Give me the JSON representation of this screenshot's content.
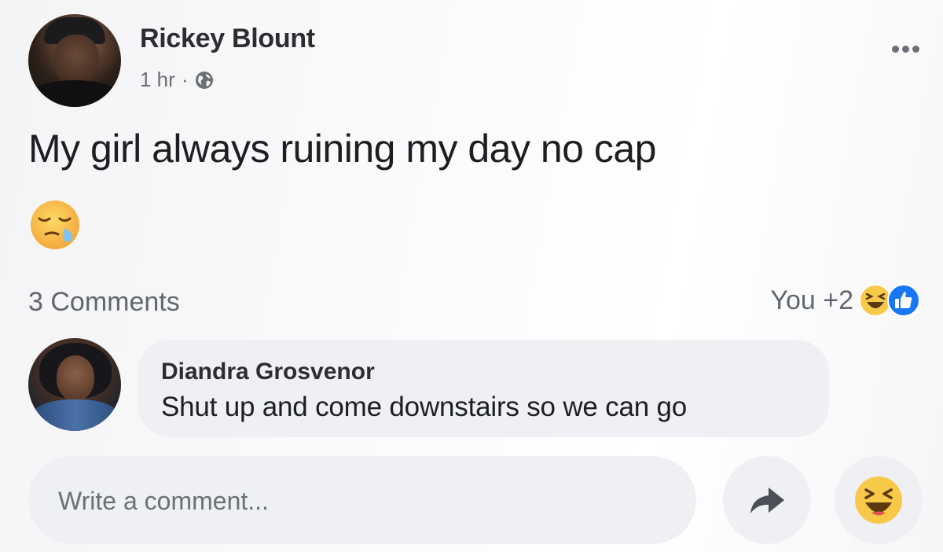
{
  "post": {
    "author_name": "Rickey Blount",
    "time": "1 hr",
    "separator": "·",
    "privacy_icon": "globe-icon",
    "text": "My girl always ruining my day no cap",
    "emoji": "sleepy-face-emoji"
  },
  "stats": {
    "comments_label": "3 Comments",
    "reactions_label": "You +2",
    "reaction_icons": [
      "haha-icon",
      "like-icon"
    ]
  },
  "comment": {
    "author_name": "Diandra Grosvenor",
    "text": "Shut up and come downstairs so we can go"
  },
  "composer": {
    "placeholder": "Write a comment...",
    "value": ""
  },
  "colors": {
    "like_blue": "#1877f2",
    "haha_yellow": "#f7c948",
    "bubble_gray": "#eef0f4",
    "text_muted": "#606770"
  }
}
